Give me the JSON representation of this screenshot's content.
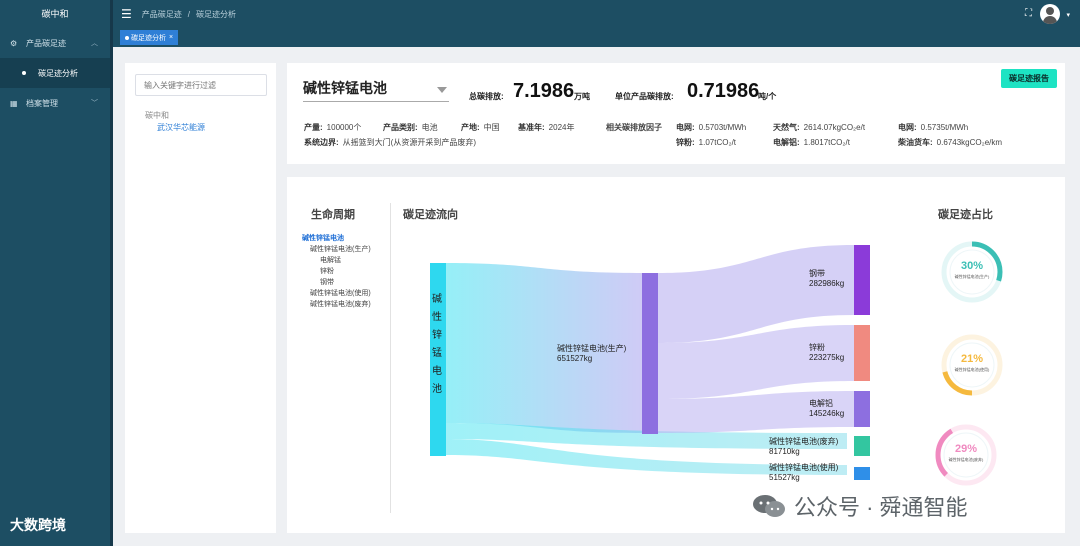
{
  "app": {
    "brand": "碳中和"
  },
  "sidebar": {
    "items": [
      {
        "label": "产品碳足迹",
        "icon": "settings-icon",
        "expanded": true,
        "children": [
          {
            "label": "碳足迹分析",
            "active": true
          }
        ]
      },
      {
        "label": "档案管理",
        "icon": "archive-icon",
        "expanded": false
      }
    ]
  },
  "topbar": {
    "breadcrumb": [
      "产品碳足迹",
      "碳足迹分析"
    ],
    "separator": "/"
  },
  "tabs": [
    {
      "label": "碳足迹分析",
      "close": "×"
    }
  ],
  "tree": {
    "placeholder": "输入关键字进行过滤",
    "root": "碳中和",
    "child": "武汉华芯能源"
  },
  "summary": {
    "product": "碱性锌锰电池",
    "total_label": "总碳排放:",
    "total_value": "7.1986",
    "total_unit": "万吨",
    "unit_label": "单位产品碳排放:",
    "unit_value": "0.71986",
    "unit_unit": "吨/个",
    "report_button": "碳足迹报告",
    "output_label": "产量:",
    "output_value": "100000个",
    "category_label": "产品类别:",
    "category_value": "电池",
    "origin_label": "产地:",
    "origin_value": "中国",
    "base_year_label": "基准年:",
    "base_year_value": "2024年",
    "boundary_label": "系统边界:",
    "boundary_value": "从摇篮到大门(从资源开采到产品废弃)",
    "factors_label": "相关碳排放因子",
    "factors": [
      {
        "label": "电网:",
        "value": "0.5703t/MWh"
      },
      {
        "label": "天然气:",
        "value": "2614.07kgCO₂e/t"
      },
      {
        "label": "电网:",
        "value": "0.5735t/MWh"
      },
      {
        "label": "锌粉:",
        "value": "1.07tCO₂/t"
      },
      {
        "label": "电解铝:",
        "value": "1.8017tCO₂/t"
      },
      {
        "label": "柴油货车:",
        "value": "0.6743kgCO₂e/km"
      }
    ]
  },
  "sections": {
    "lifecycle": "生命周期",
    "flow": "碳足迹流向",
    "share": "碳足迹占比"
  },
  "lifecycle_tree": [
    {
      "label": "碱性锌锰电池",
      "level": 0,
      "active": true
    },
    {
      "label": "碱性锌锰电池(生产)",
      "level": 1
    },
    {
      "label": "电解锰",
      "level": 2
    },
    {
      "label": "锌粉",
      "level": 2
    },
    {
      "label": "钢带",
      "level": 2
    },
    {
      "label": "碱性锌锰电池(使用)",
      "level": 1
    },
    {
      "label": "碱性锌锰电池(废弃)",
      "level": 1
    }
  ],
  "sankey": {
    "source": "碱性锌锰电池",
    "nodes": [
      {
        "name": "碱性锌锰电池(生产)",
        "value": "651527kg"
      },
      {
        "name": "钢带",
        "value": "282986kg",
        "color": "#8b3bd9"
      },
      {
        "name": "锌粉",
        "value": "223275kg",
        "color": "#f08a80"
      },
      {
        "name": "电解铝",
        "value": "145246kg",
        "color": "#8d6fe0"
      },
      {
        "name": "碱性锌锰电池(废弃)",
        "value": "81710kg",
        "color": "#33c6a0"
      },
      {
        "name": "碱性锌锰电池(使用)",
        "value": "51527kg",
        "color": "#2f8fe8"
      }
    ]
  },
  "shares": [
    {
      "pct": "30%",
      "label": "碱性锌锰电池(生产)",
      "color": "#3bbfb5",
      "value": 30
    },
    {
      "pct": "21%",
      "label": "碱性锌锰电池(使用)",
      "color": "#f5b93e",
      "value": 21
    },
    {
      "pct": "29%",
      "label": "碱性锌锰电池(废弃)",
      "color": "#f08ac0",
      "value": 29
    }
  ],
  "watermarks": {
    "left": "大数跨境",
    "right": "公众号 · 舜通智能"
  }
}
